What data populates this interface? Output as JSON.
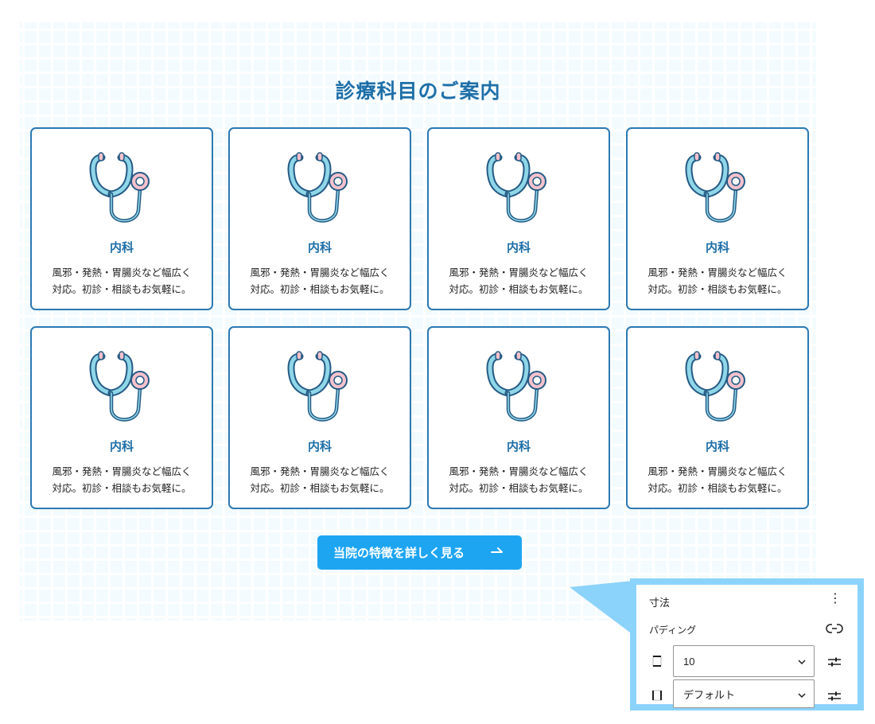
{
  "section": {
    "title": "診療科目のご案内",
    "cards": [
      {
        "title": "内科",
        "desc_line1": "風邪・発熱・胃腸炎など幅広く",
        "desc_line2": "対応。初診・相談もお気軽に。"
      },
      {
        "title": "内科",
        "desc_line1": "風邪・発熱・胃腸炎など幅広く",
        "desc_line2": "対応。初診・相談もお気軽に。"
      },
      {
        "title": "内科",
        "desc_line1": "風邪・発熱・胃腸炎など幅広く",
        "desc_line2": "対応。初診・相談もお気軽に。"
      },
      {
        "title": "内科",
        "desc_line1": "風邪・発熱・胃腸炎など幅広く",
        "desc_line2": "対応。初診・相談もお気軽に。"
      },
      {
        "title": "内科",
        "desc_line1": "風邪・発熱・胃腸炎など幅広く",
        "desc_line2": "対応。初診・相談もお気軽に。"
      },
      {
        "title": "内科",
        "desc_line1": "風邪・発熱・胃腸炎など幅広く",
        "desc_line2": "対応。初診・相談もお気軽に。"
      },
      {
        "title": "内科",
        "desc_line1": "風邪・発熱・胃腸炎など幅広く",
        "desc_line2": "対応。初診・相談もお気軽に。"
      },
      {
        "title": "内科",
        "desc_line1": "風邪・発熱・胃腸炎など幅広く",
        "desc_line2": "対応。初診・相談もお気軽に。"
      }
    ],
    "cta_label": "当院の特徴を詳しく見る",
    "cta_icon": "arrow-right-icon",
    "card_icon": "stethoscope-icon"
  },
  "panel": {
    "header": "寸法",
    "more_icon": "more-vertical-icon",
    "padding_label": "パディング",
    "link_icon": "link-icon",
    "rows": [
      {
        "value": "10",
        "side_icon": "padding-vertical-icon",
        "settings_icon": "sliders-icon"
      },
      {
        "value": "デフォルト",
        "side_icon": "padding-horizontal-icon",
        "settings_icon": "sliders-icon"
      }
    ]
  },
  "colors": {
    "accent": "#1ea5f2",
    "card_border": "#2b79b3",
    "title_text": "#1e6fa8",
    "background_tint": "#f3fbff",
    "panel_border": "#8cd3fb",
    "stethoscope_tube": "#7fd3e6",
    "stethoscope_chest": "#f6c2cd"
  }
}
